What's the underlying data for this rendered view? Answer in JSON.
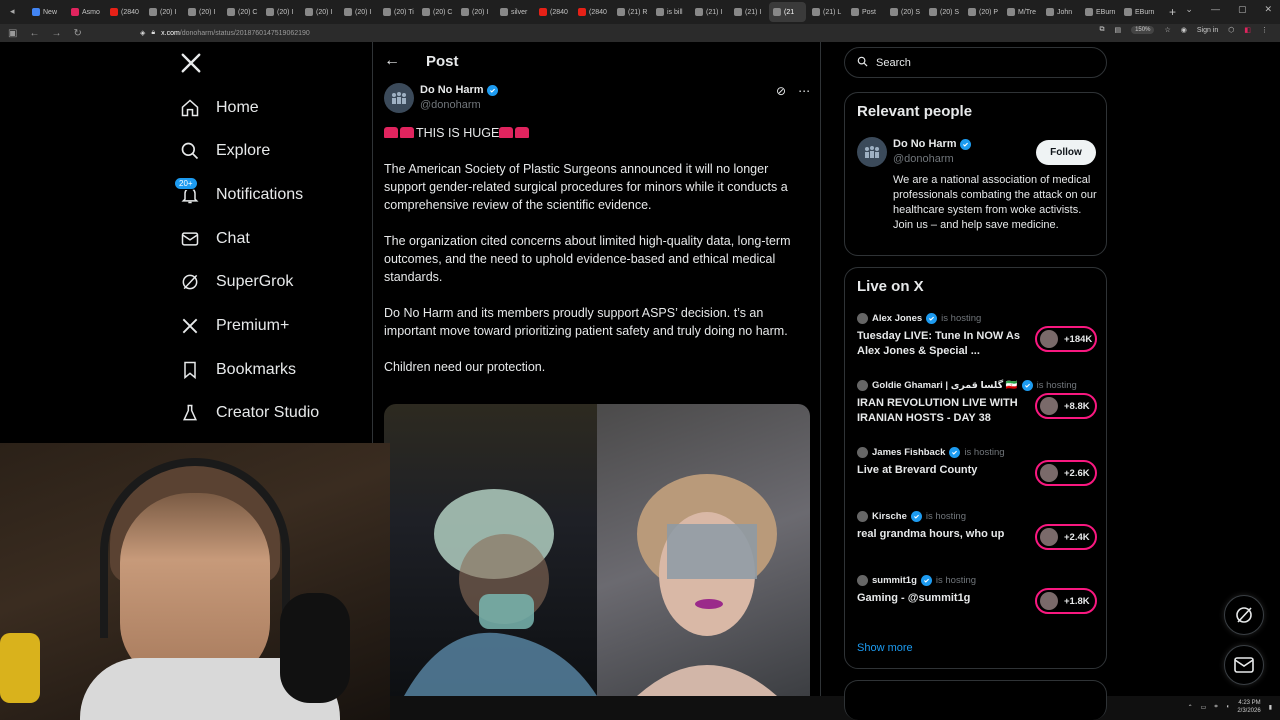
{
  "browser": {
    "tabs": [
      {
        "label": "New",
        "icon": "chrome-icon",
        "color": "#4285f4"
      },
      {
        "label": "Asmo",
        "icon": "twitch-icon",
        "color": "#e0245e"
      },
      {
        "label": "(2840",
        "icon": "youtube-icon",
        "color": "#e62117"
      },
      {
        "label": "(20) I",
        "icon": "x-icon",
        "color": "#888888"
      },
      {
        "label": "(20) I",
        "icon": "x-icon",
        "color": "#888888"
      },
      {
        "label": "(20) C",
        "icon": "x-icon",
        "color": "#888888"
      },
      {
        "label": "(20) I",
        "icon": "x-icon",
        "color": "#888888"
      },
      {
        "label": "(20) I",
        "icon": "x-icon",
        "color": "#888888"
      },
      {
        "label": "(20) I",
        "icon": "x-icon",
        "color": "#888888"
      },
      {
        "label": "(20) Ti",
        "icon": "x-icon",
        "color": "#888888"
      },
      {
        "label": "(20) C",
        "icon": "x-icon",
        "color": "#888888"
      },
      {
        "label": "(20) I",
        "icon": "x-icon",
        "color": "#888888"
      },
      {
        "label": "silver",
        "icon": "globe-icon",
        "color": "#888888"
      },
      {
        "label": "(2840",
        "icon": "youtube-icon",
        "color": "#e62117"
      },
      {
        "label": "(2840",
        "icon": "youtube-icon",
        "color": "#e62117"
      },
      {
        "label": "(21) R",
        "icon": "x-icon",
        "color": "#888888"
      },
      {
        "label": "is bill",
        "icon": "google-icon",
        "color": "#888888"
      },
      {
        "label": "(21) I",
        "icon": "x-icon",
        "color": "#888888"
      },
      {
        "label": "(21) I",
        "icon": "x-icon",
        "color": "#888888"
      },
      {
        "label": "(21",
        "icon": "x-icon",
        "color": "#888888",
        "active": true
      },
      {
        "label": "(21) L",
        "icon": "x-icon",
        "color": "#888888"
      },
      {
        "label": "Post",
        "icon": "x-icon",
        "color": "#888888"
      },
      {
        "label": "(20) S",
        "icon": "x-icon",
        "color": "#888888"
      },
      {
        "label": "(20) S",
        "icon": "x-icon",
        "color": "#888888"
      },
      {
        "label": "(20) P",
        "icon": "x-icon",
        "color": "#888888"
      },
      {
        "label": "M/Tre",
        "icon": "globe-icon",
        "color": "#888888"
      },
      {
        "label": "John",
        "icon": "globe-icon",
        "color": "#888888"
      },
      {
        "label": "EBurn",
        "icon": "globe-icon",
        "color": "#888888"
      },
      {
        "label": "EBurn",
        "icon": "globe-icon",
        "color": "#888888"
      }
    ],
    "url_host": "x.com",
    "url_path": "/donoharm/status/2018760147519062190",
    "zoom": "150%",
    "sign_in": "Sign in"
  },
  "nav": {
    "items": [
      {
        "name": "home",
        "label": "Home",
        "icon": "home-icon"
      },
      {
        "name": "explore",
        "label": "Explore",
        "icon": "search-icon"
      },
      {
        "name": "notifications",
        "label": "Notifications",
        "icon": "bell-icon",
        "badge": "20+"
      },
      {
        "name": "chat",
        "label": "Chat",
        "icon": "mail-icon"
      },
      {
        "name": "supergrok",
        "label": "SuperGrok",
        "icon": "grok-icon"
      },
      {
        "name": "premium",
        "label": "Premium+",
        "icon": "x-logo-icon"
      },
      {
        "name": "bookmarks",
        "label": "Bookmarks",
        "icon": "bookmark-icon"
      },
      {
        "name": "creator-studio",
        "label": "Creator Studio",
        "icon": "flask-icon"
      }
    ]
  },
  "post": {
    "header_title": "Post",
    "author_name": "Do No Harm",
    "author_handle": "@donoharm",
    "headline": "THIS IS HUGE",
    "paragraphs": [
      "The American Society of Plastic Surgeons announced it will no longer support gender-related surgical procedures for minors while it conducts a comprehensive review of the scientific evidence.",
      "The organization cited concerns about limited high-quality data, long-term outcomes, and the need to uphold evidence-based and ethical medical standards.",
      "Do No Harm and its members proudly support ASPS’ decision. t’s an important move toward prioritizing patient safety and truly doing no harm.",
      "Children need our protection."
    ]
  },
  "right": {
    "search_placeholder": "Search",
    "relevant": {
      "title": "Relevant people",
      "name": "Do No Harm",
      "handle": "@donoharm",
      "follow_label": "Follow",
      "bio": "We are a national association of medical professionals combating the attack on our healthcare system from woke activists. Join us – and help save medicine."
    },
    "live": {
      "title": "Live on X",
      "hosting_label": "is hosting",
      "items": [
        {
          "host": "Alex Jones",
          "title": "Tuesday LIVE: Tune In NOW As Alex Jones & Special ...",
          "count": "+184K"
        },
        {
          "host": "Goldie Ghamari | گلسا قمری 🇮🇷",
          "title": "IRAN REVOLUTION LIVE WITH IRANIAN HOSTS - DAY 38",
          "count": "+8.8K"
        },
        {
          "host": "James Fishback",
          "title": "Live at Brevard County",
          "count": "+2.6K"
        },
        {
          "host": "Kirsche",
          "title": "real grandma hours, who up",
          "count": "+2.4K"
        },
        {
          "host": "summit1g",
          "title": "Gaming - @summit1g",
          "count": "+1.8K"
        }
      ],
      "show_more": "Show more"
    }
  },
  "tray": {
    "time": "4:23 PM",
    "date": "2/3/2026"
  },
  "colors": {
    "accent": "#1d9bf0",
    "live_ring": "#f91880",
    "siren": "#e0245e"
  }
}
